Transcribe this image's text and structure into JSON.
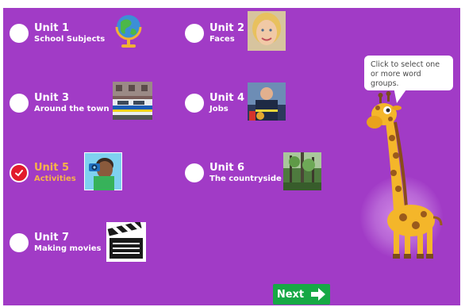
{
  "units": [
    {
      "title": "Unit 1",
      "subtitle": "School Subjects",
      "selected": false,
      "thumb_icon": "globe-icon"
    },
    {
      "title": "Unit 2",
      "subtitle": "Faces",
      "selected": false,
      "thumb_icon": "girl-face-photo"
    },
    {
      "title": "Unit 3",
      "subtitle": "Around the town",
      "selected": false,
      "thumb_icon": "police-car-photo"
    },
    {
      "title": "Unit 4",
      "subtitle": "Jobs",
      "selected": false,
      "thumb_icon": "firefighter-photo"
    },
    {
      "title": "Unit 5",
      "subtitle": "Activities",
      "selected": true,
      "thumb_icon": "boy-camera-icon"
    },
    {
      "title": "Unit 6",
      "subtitle": "The countryside",
      "selected": false,
      "thumb_icon": "forest-photo"
    },
    {
      "title": "Unit 7",
      "subtitle": "Making movies",
      "selected": false,
      "thumb_icon": "clapperboard-icon"
    }
  ],
  "speech_bubble": "Click to select one or more word groups.",
  "next_button": {
    "label": "Next",
    "icon": "arrow-right-icon"
  },
  "colors": {
    "background": "#a13bc6",
    "selected_text": "#f6b34a",
    "next_button": "#17a845",
    "checked_radio": "#e21b2c"
  }
}
